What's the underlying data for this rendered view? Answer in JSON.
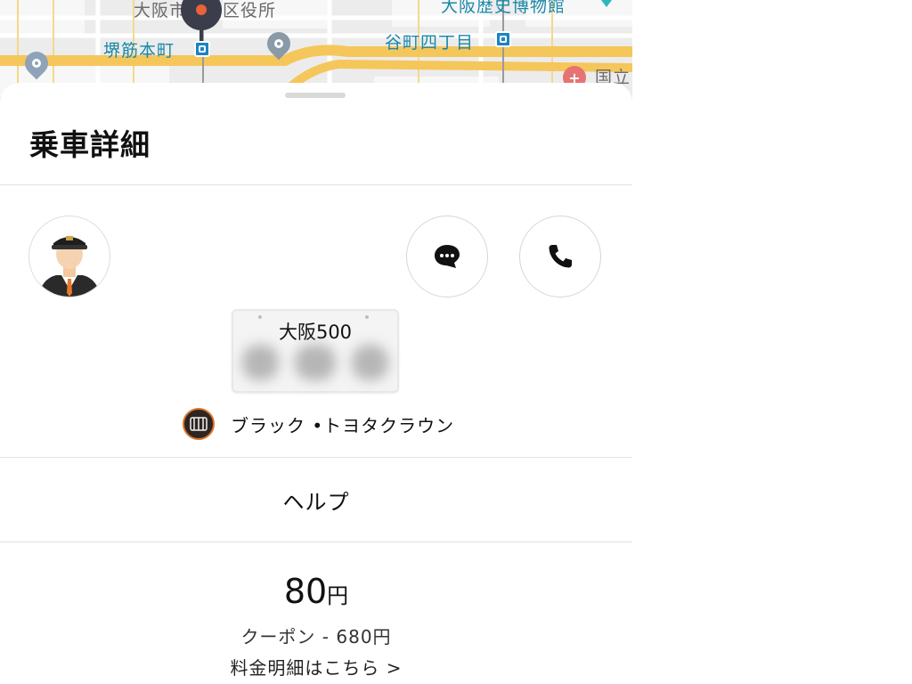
{
  "map": {
    "labels": {
      "city_office": "大阪市中央区役所",
      "station_sakaisuji": "堺筋本町",
      "station_tanimachi": "谷町四丁目",
      "museum": "大阪歴史博物館",
      "hospital": "国立"
    },
    "icons": {
      "pickup_pin": "map-pin-icon",
      "poi": "poi-marker-icon",
      "hospital": "hospital-icon",
      "police": "police-icon"
    }
  },
  "sheet": {
    "title": "乗車詳細",
    "driver": {
      "avatar": "driver-avatar",
      "name": ""
    },
    "actions": {
      "message_icon": "chat-bubble-icon",
      "call_icon": "phone-icon"
    },
    "plate": {
      "region": "大阪500"
    },
    "vehicle": {
      "description": "ブラック •トヨタクラウン"
    },
    "help_label": "ヘルプ",
    "fare": {
      "amount": "80",
      "unit": "円",
      "coupon": "クーポン - 680円",
      "details_link": "料金明細はこちら > "
    }
  },
  "colors": {
    "station_blue": "#1a84c4",
    "map_road_yellow": "#f5c65a",
    "pin_orange": "#e8623a",
    "text": "#111111"
  }
}
